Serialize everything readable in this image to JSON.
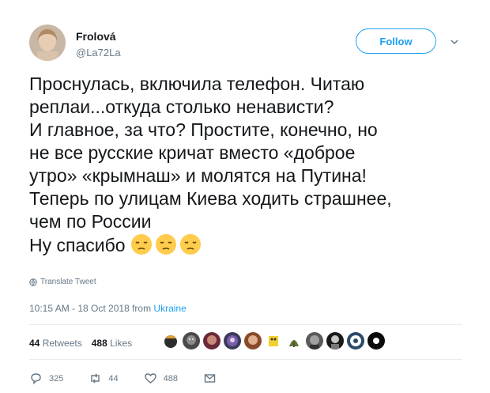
{
  "author": {
    "name": "Frolová",
    "handle": "@La72La"
  },
  "follow_label": "Follow",
  "tweet": {
    "lines": [
      "Проснулась, включила телефон. Читаю",
      "реплаи...откуда столько ненависти?",
      "И главное, за что? Простите, конечно, но",
      "не все русские кричат вместо «доброе",
      "утро» «крымнаш» и молятся на Путина!",
      "Теперь по улицам Киева ходить страшнее,",
      "чем по России",
      "Ну спасибо"
    ],
    "emojis": [
      "pensive-face-emoji",
      "pensive-face-emoji",
      "pensive-face-emoji"
    ]
  },
  "translate_label": "Translate Tweet",
  "timestamp": "10:15 AM - 18 Oct 2018 from",
  "location": "Ukraine",
  "stats": {
    "retweets_count": "44",
    "retweets_label": "Retweets",
    "likes_count": "488",
    "likes_label": "Likes"
  },
  "actions": {
    "replies": "325",
    "retweets": "44",
    "likes": "488"
  },
  "colors": {
    "accent": "#1da1f2",
    "muted": "#657786",
    "text": "#14171a"
  }
}
